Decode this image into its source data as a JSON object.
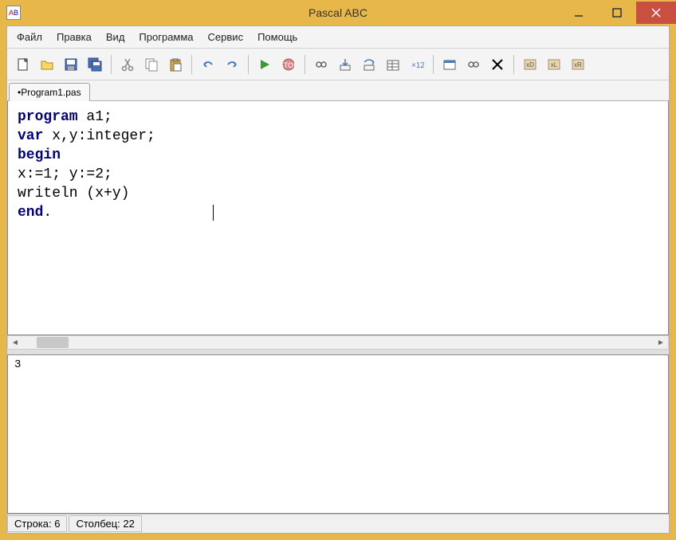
{
  "titlebar": {
    "title": "Pascal ABC"
  },
  "menu": {
    "items": [
      "Файл",
      "Правка",
      "Вид",
      "Программа",
      "Сервис",
      "Помощь"
    ]
  },
  "tab": {
    "label": "•Program1.pas"
  },
  "code": {
    "l1a": "program",
    "l1b": " a1;",
    "l2a": "var",
    "l2b": " x,y:integer;",
    "l3": "begin",
    "l4": "x:=1; y:=2;",
    "l5": "writeln (x+y)",
    "l6a": "end",
    "l6b": "."
  },
  "output": {
    "text": "3"
  },
  "status": {
    "row": "Строка: 6",
    "col": "Столбец: 22"
  },
  "icons": {
    "new": "new-file",
    "open": "open",
    "save": "save",
    "saveall": "save-all",
    "cut": "cut",
    "copy": "copy",
    "paste": "paste",
    "undo": "undo",
    "redo": "redo",
    "run": "run",
    "stop": "stop",
    "trace": "trace",
    "stepin": "step-in",
    "stepover": "step-over",
    "watch": "watch",
    "eval": "eval",
    "win1": "window",
    "win2": "window2",
    "del": "delete",
    "d1": "d1",
    "d2": "d2",
    "d3": "d3"
  }
}
